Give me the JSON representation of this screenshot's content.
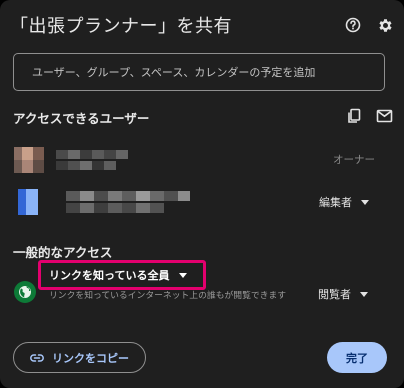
{
  "dialog": {
    "title": "「出張プランナー」を共有",
    "help_icon": "help-circle-icon",
    "settings_icon": "gear-icon"
  },
  "search": {
    "placeholder": "ユーザー、グループ、スペース、カレンダーの予定を追加"
  },
  "people": {
    "heading": "アクセスできるユーザー",
    "copy_icon": "copy-icon",
    "email_icon": "mail-icon",
    "users": [
      {
        "role": "オーナー"
      },
      {
        "role": "編集者"
      }
    ]
  },
  "general_access": {
    "heading": "一般的なアクセス",
    "scope": "リンクを知っている全員",
    "description": "リンクを知っているインターネット上の誰もが閲覧できます",
    "role": "閲覧者",
    "globe_icon": "globe-icon"
  },
  "footer": {
    "copy_link_label": "リンクをコピー",
    "done_label": "完了"
  },
  "colors": {
    "background": "#1f1f1f",
    "accent": "#a8c7fa",
    "highlight": "#e3006e",
    "globe": "#0d7a37"
  }
}
